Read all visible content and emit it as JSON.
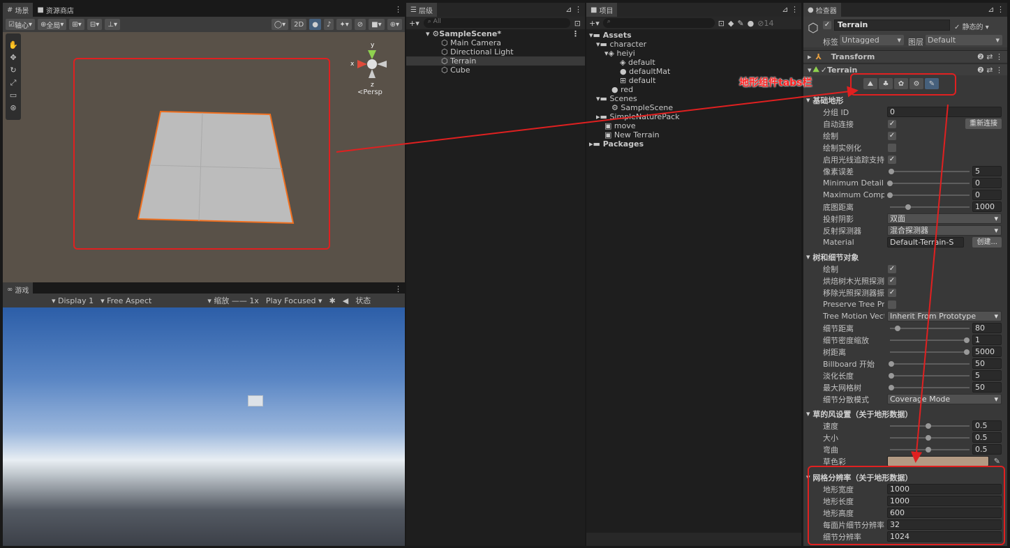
{
  "scene": {
    "tab_scene": "场景",
    "tab_store": "资源商店",
    "pivot": "轴心",
    "global": "全局",
    "btn_2d": "2D",
    "persp": "<Persp",
    "axis_y": "y",
    "axis_x": "x",
    "axis_z": "z"
  },
  "game": {
    "tab": "游戏",
    "display": "Display 1",
    "aspect": "Free Aspect",
    "zoom": "缩放",
    "zoom_val": "1x",
    "play": "Play Focused",
    "stats": "状态"
  },
  "hierarchy": {
    "tab": "层级",
    "search": "All",
    "scene": "SampleScene*",
    "items": [
      "Main Camera",
      "Directional Light",
      "Terrain",
      "Cube"
    ]
  },
  "project": {
    "tab": "项目",
    "count": "14",
    "items": [
      "Assets",
      "character",
      "heiyi",
      "default",
      "defaultMat",
      "default",
      "red",
      "Scenes",
      "SampleScene",
      "SimpleNaturePack",
      "move",
      "New Terrain",
      "Packages"
    ]
  },
  "inspector": {
    "tab": "检查器",
    "name": "Terrain",
    "static": "静态的",
    "tag_label": "标签",
    "tag": "Untagged",
    "layer_label": "图层",
    "layer": "Default",
    "transform": "Transform",
    "terrain": "Terrain",
    "annotation": "地形组件tabs栏",
    "basic_section": "基础地形",
    "basic": [
      {
        "label": "分组 ID",
        "type": "field",
        "value": "0"
      },
      {
        "label": "自动连接",
        "type": "check",
        "value": "✓",
        "button": "重新连接"
      },
      {
        "label": "绘制",
        "type": "check",
        "value": "✓"
      },
      {
        "label": "绘制实例化",
        "type": "check",
        "value": ""
      },
      {
        "label": "启用光线追踪支持",
        "type": "check",
        "value": "✓"
      },
      {
        "label": "像素误差",
        "type": "slider",
        "value": "5",
        "pos": 0.02
      },
      {
        "label": "Minimum Detail L",
        "type": "slider",
        "value": "0",
        "pos": 0.0
      },
      {
        "label": "Maximum Comple",
        "type": "slider",
        "value": "0",
        "pos": 0.0
      },
      {
        "label": "底图距离",
        "type": "slider",
        "value": "1000",
        "pos": 0.24
      },
      {
        "label": "投射阴影",
        "type": "dropdown",
        "value": "双面"
      },
      {
        "label": "反射探测器",
        "type": "dropdown",
        "value": "混合探测器"
      },
      {
        "label": "Material",
        "type": "field",
        "value": "Default-Terrain-S",
        "button": "创建..."
      }
    ],
    "tree_section": "树和细节对象",
    "tree": [
      {
        "label": "绘制",
        "type": "check",
        "value": "✓"
      },
      {
        "label": "烘焙树木光照探测器",
        "type": "check",
        "value": "✓"
      },
      {
        "label": "移除光照探测器振铃",
        "type": "check",
        "value": "✓"
      },
      {
        "label": "Preserve Tree Pro",
        "type": "check",
        "value": ""
      },
      {
        "label": "Tree Motion Vect",
        "type": "dropdown",
        "value": "Inherit From Prototype"
      },
      {
        "label": "细节距离",
        "type": "slider",
        "value": "80",
        "pos": 0.1
      },
      {
        "label": "细节密度缩放",
        "type": "slider",
        "value": "1",
        "pos": 1.0
      },
      {
        "label": "树距离",
        "type": "slider",
        "value": "5000",
        "pos": 1.0
      },
      {
        "label": "Billboard 开始",
        "type": "slider",
        "value": "50",
        "pos": 0.02
      },
      {
        "label": "淡化长度",
        "type": "slider",
        "value": "5",
        "pos": 0.02
      },
      {
        "label": "最大网格树",
        "type": "slider",
        "value": "50",
        "pos": 0.02
      },
      {
        "label": "细节分散模式",
        "type": "dropdown",
        "value": "Coverage Mode"
      }
    ],
    "wind_section": "草的风设置（关于地形数据）",
    "wind": [
      {
        "label": "速度",
        "type": "slider",
        "value": "0.5",
        "pos": 0.5
      },
      {
        "label": "大小",
        "type": "slider",
        "value": "0.5",
        "pos": 0.5
      },
      {
        "label": "弯曲",
        "type": "slider",
        "value": "0.5",
        "pos": 0.5
      },
      {
        "label": "草色彩",
        "type": "color",
        "value": ""
      }
    ],
    "mesh_section": "网格分辨率（关于地形数据）",
    "mesh": [
      {
        "label": "地形宽度",
        "type": "field",
        "value": "1000"
      },
      {
        "label": "地形长度",
        "type": "field",
        "value": "1000"
      },
      {
        "label": "地形高度",
        "type": "field",
        "value": "600"
      },
      {
        "label": "每面片细节分辨率",
        "type": "field",
        "value": "32"
      },
      {
        "label": "细节分辨率",
        "type": "field",
        "value": "1024"
      }
    ]
  },
  "colors": {
    "accent": "#e02020",
    "selection": "#3e5f96",
    "grass": "#b39a83"
  }
}
